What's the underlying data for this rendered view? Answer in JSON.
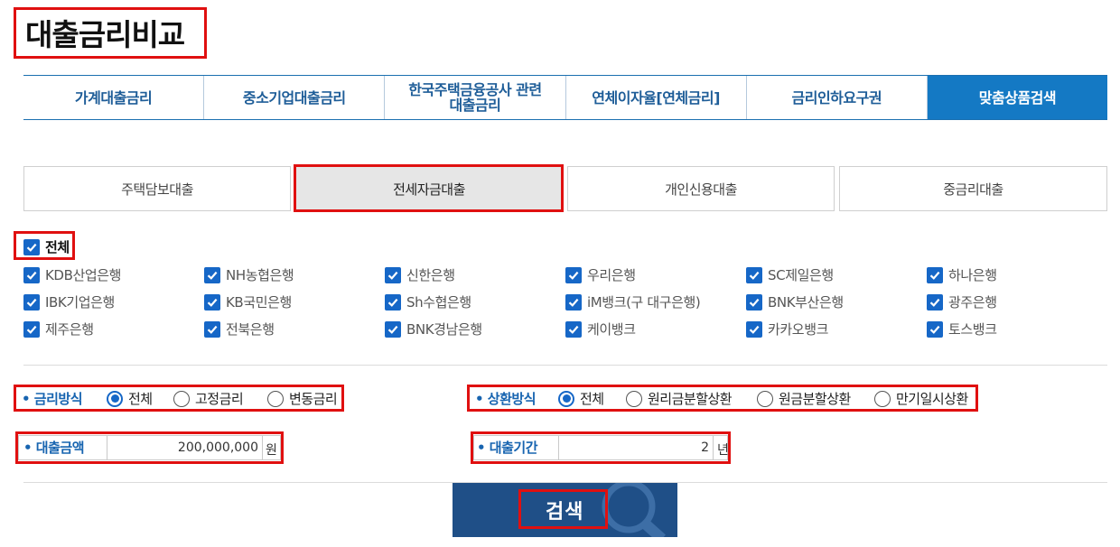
{
  "page": {
    "title": "대출금리비교"
  },
  "main_tabs": [
    {
      "label": "가계대출금리"
    },
    {
      "label": "중소기업대출금리"
    },
    {
      "label": "한국주택금융공사 관련\n대출금리"
    },
    {
      "label": "연체이자율[연체금리]"
    },
    {
      "label": "금리인하요구권"
    },
    {
      "label": "맞춤상품검색",
      "active": true
    }
  ],
  "sub_tabs": [
    {
      "label": "주택담보대출"
    },
    {
      "label": "전세자금대출",
      "active": true
    },
    {
      "label": "개인신용대출"
    },
    {
      "label": "중금리대출"
    }
  ],
  "banks": {
    "all_label": "전체",
    "all_checked": true,
    "items": [
      {
        "label": "KDB산업은행",
        "checked": true
      },
      {
        "label": "NH농협은행",
        "checked": true
      },
      {
        "label": "신한은행",
        "checked": true
      },
      {
        "label": "우리은행",
        "checked": true
      },
      {
        "label": "SC제일은행",
        "checked": true
      },
      {
        "label": "하나은행",
        "checked": true
      },
      {
        "label": "IBK기업은행",
        "checked": true
      },
      {
        "label": "KB국민은행",
        "checked": true
      },
      {
        "label": "Sh수협은행",
        "checked": true
      },
      {
        "label": "iM뱅크(구 대구은행)",
        "checked": true
      },
      {
        "label": "BNK부산은행",
        "checked": true
      },
      {
        "label": "광주은행",
        "checked": true
      },
      {
        "label": "제주은행",
        "checked": true
      },
      {
        "label": "전북은행",
        "checked": true
      },
      {
        "label": "BNK경남은행",
        "checked": true
      },
      {
        "label": "케이뱅크",
        "checked": true
      },
      {
        "label": "카카오뱅크",
        "checked": true
      },
      {
        "label": "토스뱅크",
        "checked": true
      }
    ]
  },
  "rate_type": {
    "title": "• 금리방식",
    "options": [
      "전체",
      "고정금리",
      "변동금리"
    ],
    "selected": "전체"
  },
  "repay_type": {
    "title": "• 상환방식",
    "options": [
      "전체",
      "원리금분할상환",
      "원금분할상환",
      "만기일시상환"
    ],
    "selected": "전체"
  },
  "loan_amount": {
    "title": "• 대출금액",
    "value": "200,000,000",
    "unit": "원"
  },
  "loan_period": {
    "title": "• 대출기간",
    "value": "2",
    "unit": "년"
  },
  "search_button": {
    "label": "검색"
  },
  "colors": {
    "accent": "#1479c4",
    "brand_dark": "#1f4f87",
    "highlight": "#e01010"
  }
}
